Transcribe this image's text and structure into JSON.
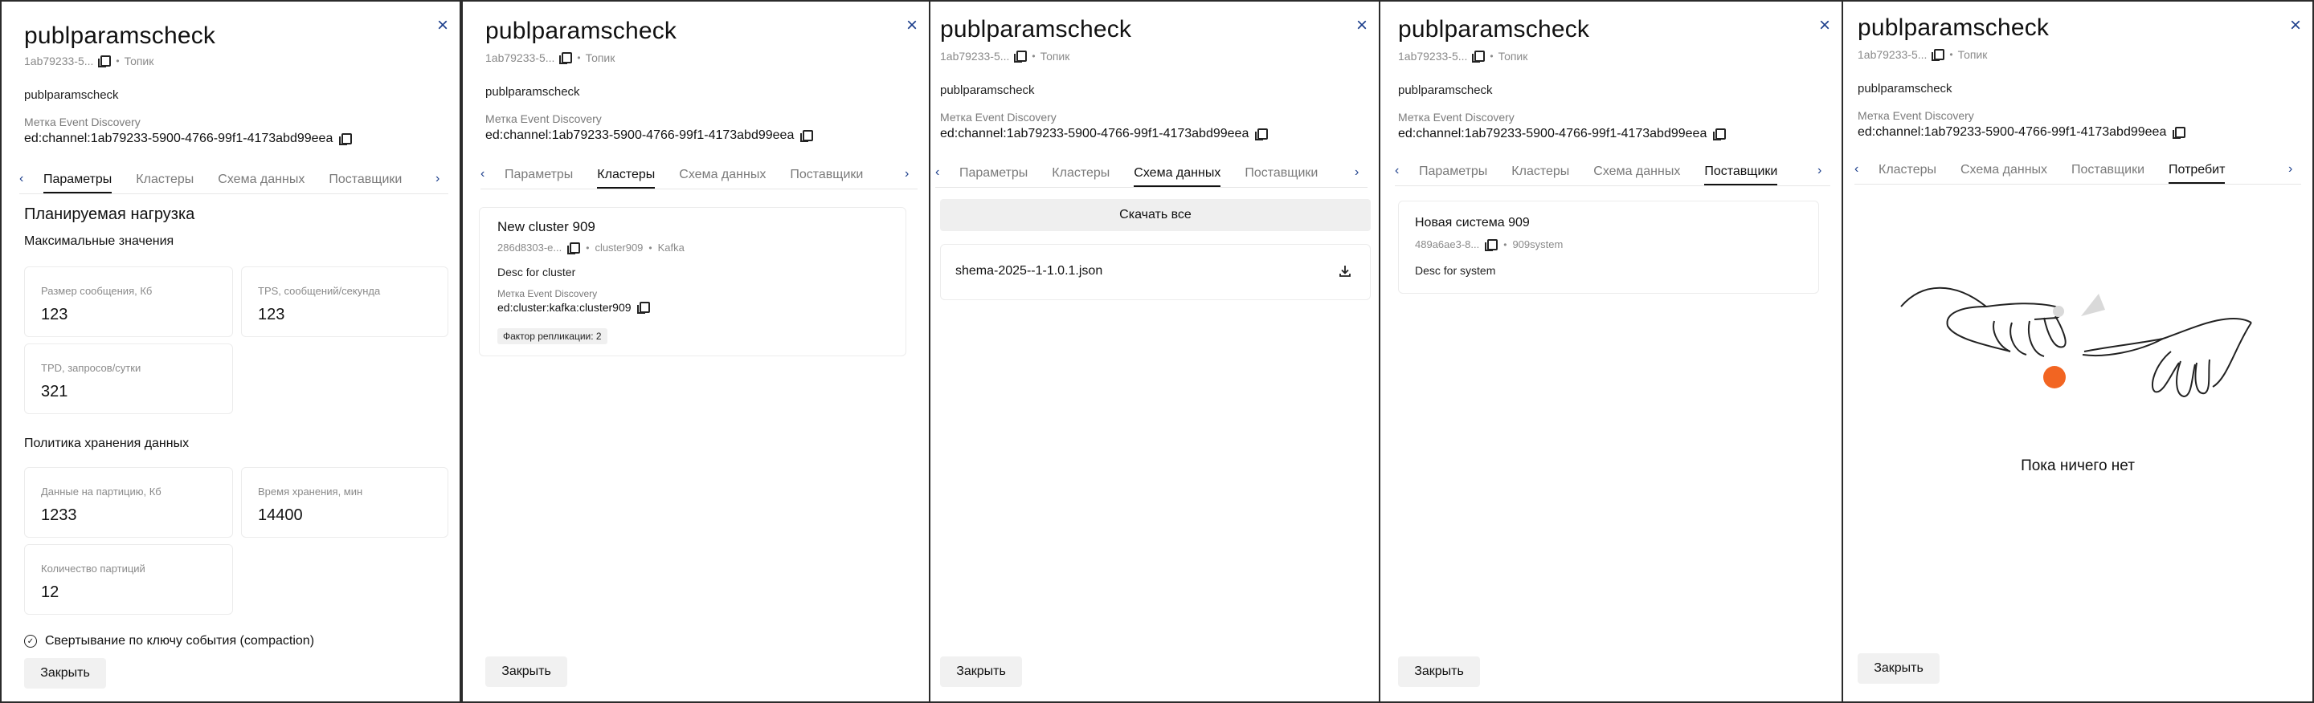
{
  "common": {
    "title": "publparamscheck",
    "id_short": "1ab79233-5...",
    "entity_type": "Топик",
    "name": "publparamscheck",
    "ed_label": "Метка Event Discovery",
    "ed_value": "ed:channel:1ab79233-5900-4766-99f1-4173abd99eea",
    "close_label": "Закрыть",
    "close_icon": "×",
    "arrow_left": "‹",
    "arrow_right": "›"
  },
  "tabs": {
    "params": "Параметры",
    "clusters": "Кластеры",
    "schema": "Схема данных",
    "suppliers": "Поставщики",
    "consumers": "Потребит"
  },
  "params_panel": {
    "planned_load": "Планируемая нагрузка",
    "max_values": "Максимальные значения",
    "msg_size_label": "Размер сообщения, Кб",
    "msg_size_value": "123",
    "tps_label": "TPS, сообщений/секунда",
    "tps_value": "123",
    "tpd_label": "TPD, запросов/сутки",
    "tpd_value": "321",
    "retention_policy": "Политика хранения данных",
    "partition_data_label": "Данные на партицию, Кб",
    "partition_data_value": "1233",
    "retention_time_label": "Время хранения, мин",
    "retention_time_value": "14400",
    "partitions_label": "Количество партиций",
    "partitions_value": "12",
    "compaction_label": "Свертывание по ключу события (compaction)"
  },
  "clusters_panel": {
    "cluster_name": "New cluster 909",
    "cluster_id": "286d8303-e...",
    "cluster_code": "cluster909",
    "cluster_type": "Kafka",
    "cluster_desc": "Desc for cluster",
    "ed_label": "Метка Event Discovery",
    "ed_value": "ed:cluster:kafka:cluster909",
    "replication": "Фактор репликации: 2"
  },
  "schema_panel": {
    "download_all": "Скачать все",
    "file_name": "shema-2025--1-1.0.1.json"
  },
  "suppliers_panel": {
    "system_name": "Новая система 909",
    "system_id": "489a6ae3-8...",
    "system_code": "909system",
    "system_desc": "Desc for system"
  },
  "consumers_panel": {
    "empty_text": "Пока ничего нет"
  },
  "colors": {
    "accent": "#1d3f8c",
    "illustration_dot": "#f26522"
  }
}
